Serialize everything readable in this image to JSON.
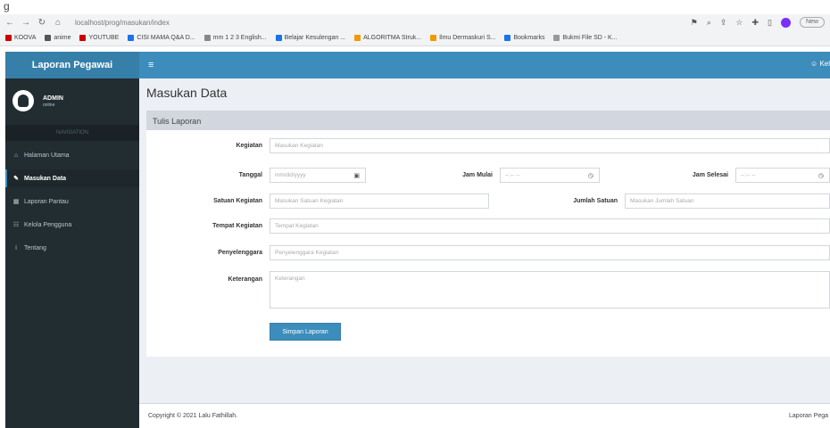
{
  "caption": "g",
  "browser": {
    "url": "localhost/prog/masukan/index",
    "new_button": "New"
  },
  "bookmarks": [
    {
      "label": "KOOVA",
      "color": "#cc0000"
    },
    {
      "label": "anime",
      "color": "#555555"
    },
    {
      "label": "YOUTUBE",
      "color": "#cc0000"
    },
    {
      "label": "CISI MAMA Q&A D...",
      "color": "#1a73e8"
    },
    {
      "label": "mm 1 2 3 English...",
      "color": "#888888"
    },
    {
      "label": "Belajar Kesulengan ...",
      "color": "#1a73e8"
    },
    {
      "label": "ALGORITMA Struk...",
      "color": "#f29900"
    },
    {
      "label": "Ilmu Dermaskuri S...",
      "color": "#f29900"
    },
    {
      "label": "Bookmarks",
      "color": "#1a73e8"
    },
    {
      "label": "Bukmi File SD - K...",
      "color": "#999999"
    }
  ],
  "app": {
    "brand": "Laporan Pegawai",
    "top_right": "Kel",
    "user": {
      "name": "ADMIN",
      "role": "online"
    },
    "menu_header": "NAVIGATION",
    "menu": [
      {
        "label": "Halaman Utama",
        "icon": "home-icon",
        "glyph": "⌂",
        "active": false
      },
      {
        "label": "Masukan Data",
        "icon": "edit-icon",
        "glyph": "✎",
        "active": true
      },
      {
        "label": "Laporan Pantau",
        "icon": "table-icon",
        "glyph": "▦",
        "active": false
      },
      {
        "label": "Kelola Pengguna",
        "icon": "users-icon",
        "glyph": "☷",
        "active": false
      },
      {
        "label": "Tentang",
        "icon": "info-icon",
        "glyph": "i",
        "active": false
      }
    ],
    "page_title": "Masukan Data",
    "box_title": "Tulis Laporan",
    "form": {
      "kegiatan": {
        "label": "Kegiatan",
        "placeholder": "Masukan Kegiatan"
      },
      "tanggal": {
        "label": "Tanggal",
        "placeholder": "mm/dd/yyyy"
      },
      "jam_mulai": {
        "label": "Jam Mulai",
        "placeholder": "--:-- --"
      },
      "jam_selesai": {
        "label": "Jam Selesai",
        "placeholder": "--:-- --"
      },
      "satuan": {
        "label": "Satuan Kegiatan",
        "placeholder": "Masukan Satuan Kegiatan"
      },
      "jumlah": {
        "label": "Jumlah Satuan",
        "placeholder": "Masukan Jumlah Satuan"
      },
      "tempat": {
        "label": "Tempat Kegiatan",
        "placeholder": "Tempat Kegiatan"
      },
      "penyelenggara": {
        "label": "Penyelenggara",
        "placeholder": "Penyelenggara Kegiatan"
      },
      "keterangan": {
        "label": "Keterangan",
        "placeholder": "Keterangan"
      },
      "submit": "Simpan Laporan"
    },
    "footer": "Copyright © 2021 Lalu Fathillah.",
    "footer_right": "Laporan Pega"
  }
}
